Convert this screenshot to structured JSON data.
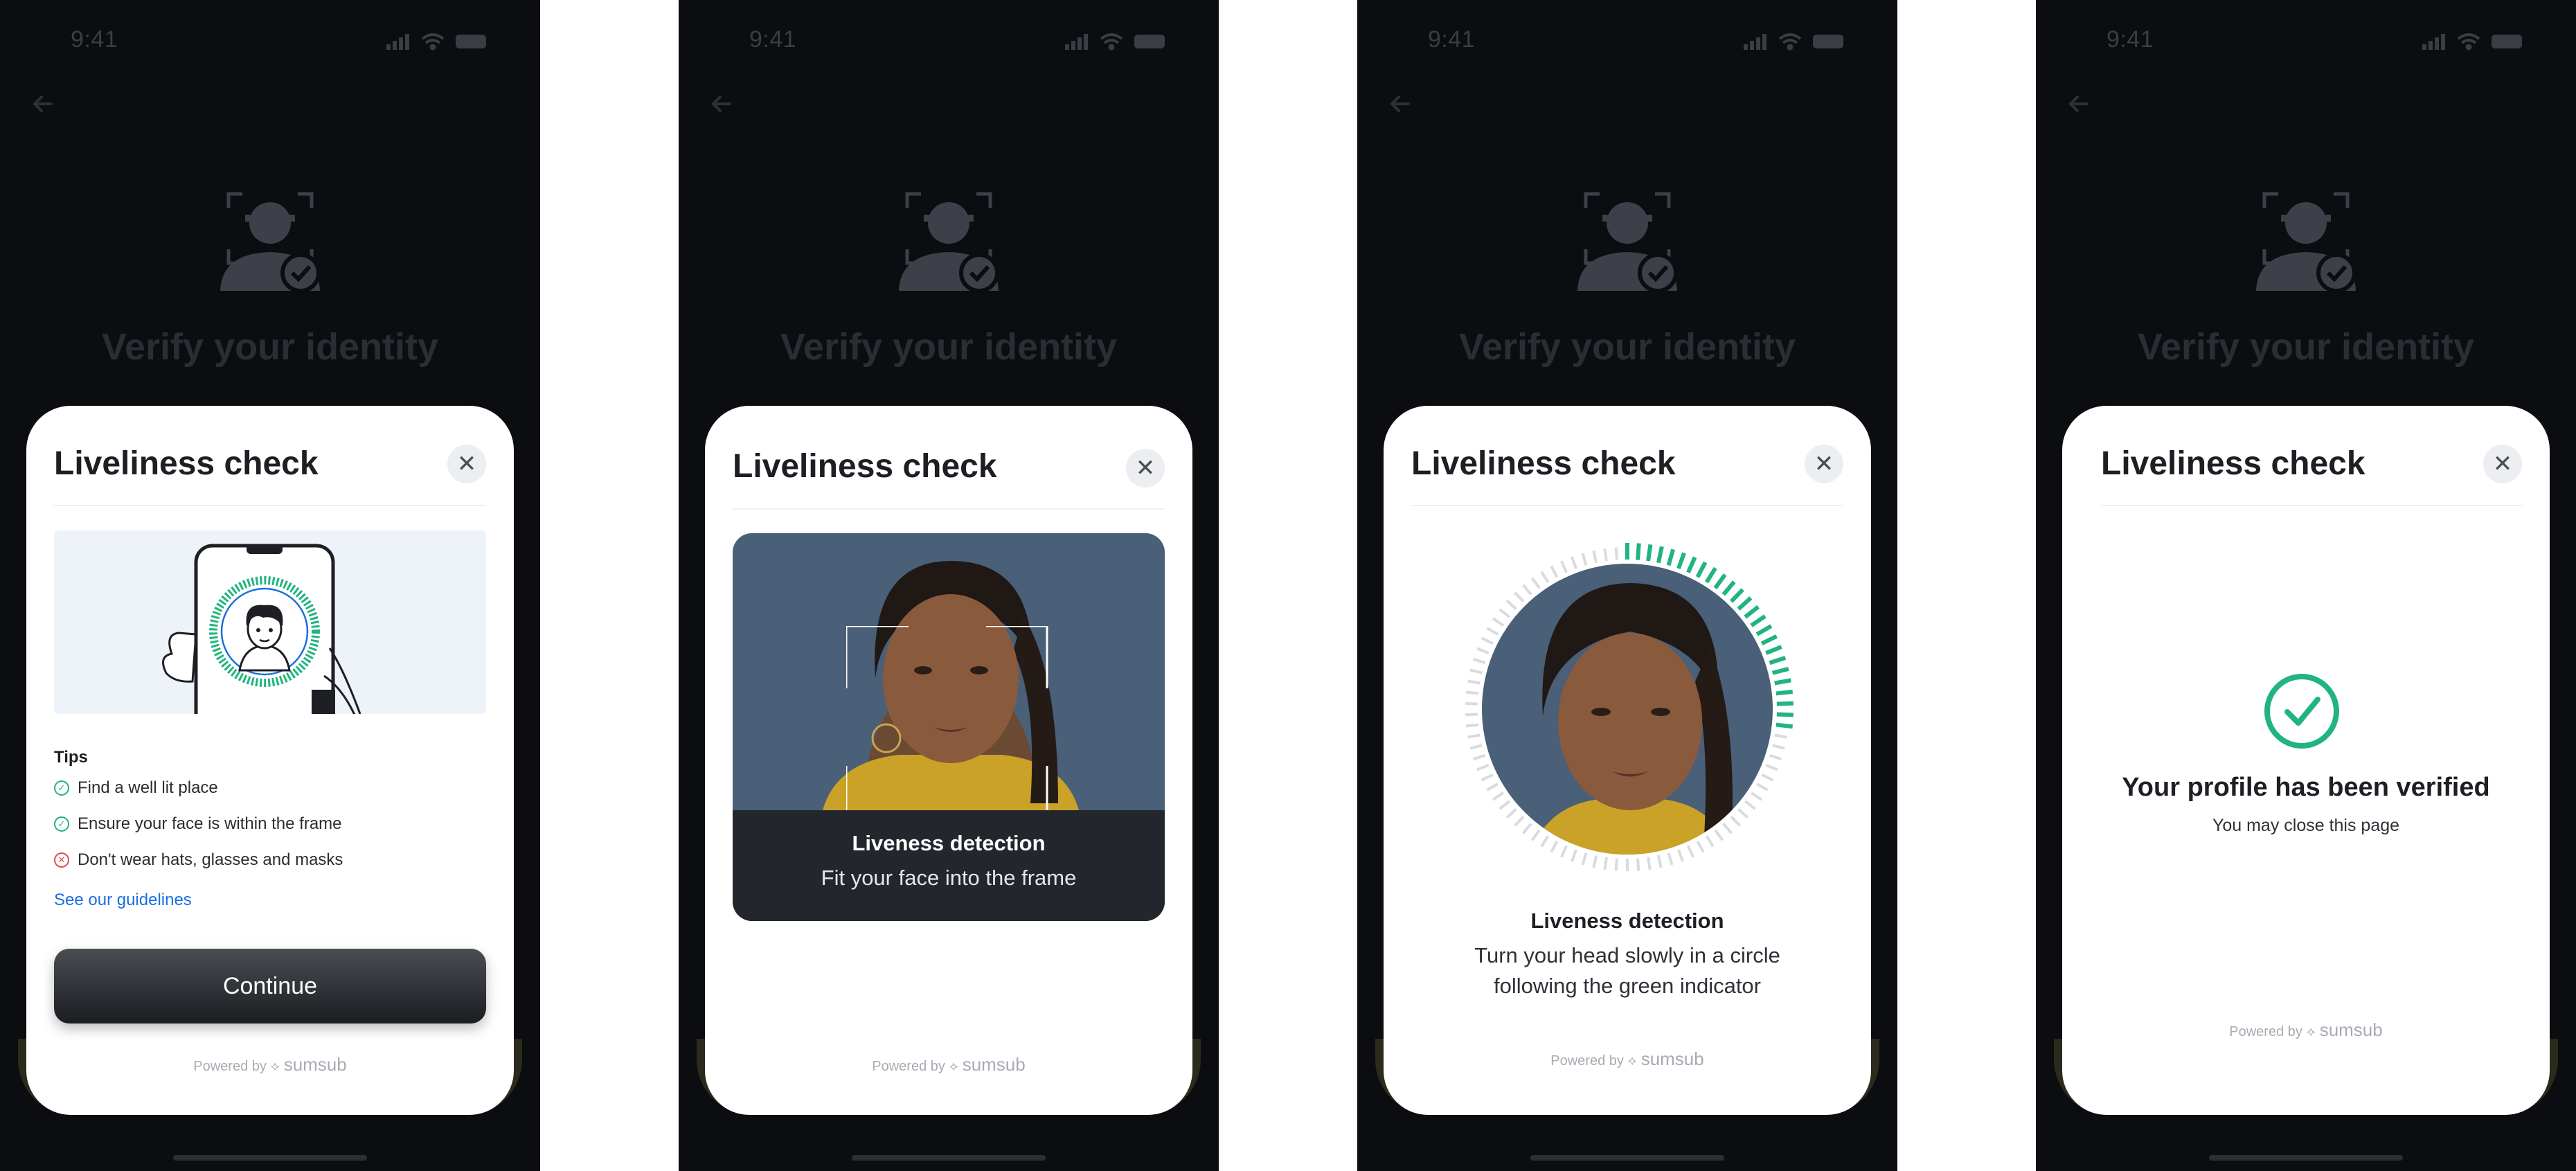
{
  "status": {
    "time": "9:41"
  },
  "background": {
    "title": "Verify your identity"
  },
  "sheet": {
    "title": "Liveliness check"
  },
  "screen1": {
    "tips_heading": "Tips",
    "tips": [
      {
        "text": "Find a well lit place",
        "type": "ok"
      },
      {
        "text": "Ensure your face is within the frame",
        "type": "ok"
      },
      {
        "text": "Don't wear hats, glasses and masks",
        "type": "bad"
      }
    ],
    "guidelines_link": "See our guidelines",
    "continue_label": "Continue"
  },
  "screen2": {
    "caption_title": "Liveness detection",
    "caption_sub": "Fit your face into the frame"
  },
  "screen3": {
    "title": "Liveness detection",
    "line1": "Turn your head slowly in a circle",
    "line2": "following the green indicator"
  },
  "screen4": {
    "title": "Your profile has been verified",
    "sub": "You may close this page"
  },
  "footer": {
    "powered_by": "Powered by",
    "brand": "sumsub"
  },
  "colors": {
    "accent_green": "#21b47e",
    "link_blue": "#1a6fe0",
    "error_red": "#e0474a",
    "dark_bg": "#0c0d10"
  },
  "icons": [
    "signal-icon",
    "wifi-icon",
    "battery-icon",
    "back-arrow-icon",
    "face-scan-icon",
    "close-icon",
    "check-icon",
    "error-icon",
    "sumsub-logo-icon"
  ]
}
